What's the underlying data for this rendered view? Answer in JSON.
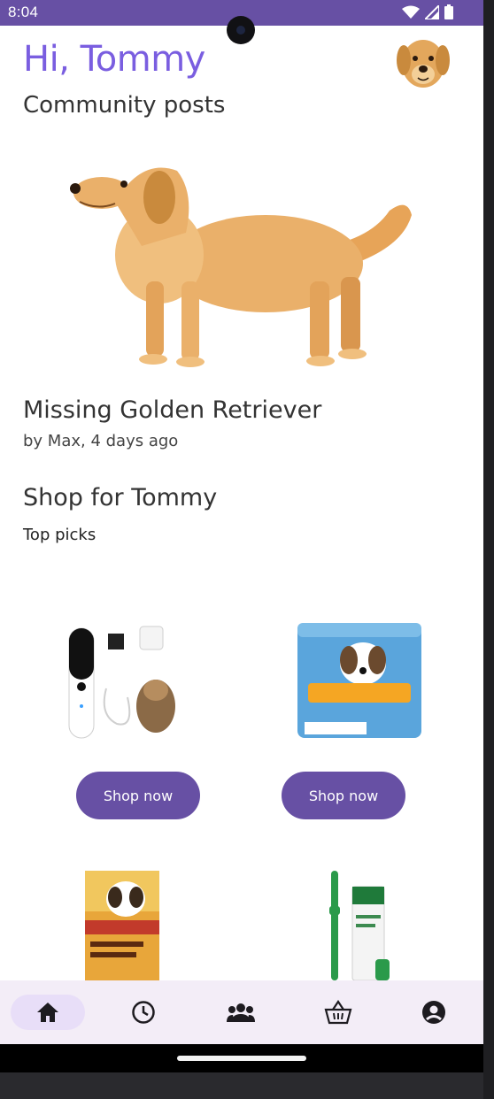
{
  "status_bar": {
    "time": "8:04",
    "icons": [
      "wifi-icon",
      "signal-icon",
      "battery-icon"
    ]
  },
  "header": {
    "greeting": "Hi, Tommy",
    "avatar_icon": "dog-avatar-icon"
  },
  "community": {
    "title": "Community posts",
    "post": {
      "image_icon": "golden-retriever-image",
      "title": "Missing Golden Retriever",
      "meta": "by Max, 4 days ago"
    }
  },
  "shop": {
    "title": "Shop for Tommy",
    "subtitle": "Top picks",
    "products": [
      {
        "image_icon": "nail-grinder-product-image",
        "button_label": "Shop now"
      },
      {
        "image_icon": "dog-wraps-product-image",
        "button_label": "Shop now"
      },
      {
        "image_icon": "flea-treatment-product-image"
      },
      {
        "image_icon": "toothpaste-kit-product-image"
      }
    ]
  },
  "bottom_nav": {
    "items": [
      {
        "icon": "home-icon",
        "active": true
      },
      {
        "icon": "clock-icon",
        "active": false
      },
      {
        "icon": "community-icon",
        "active": false
      },
      {
        "icon": "basket-icon",
        "active": false
      },
      {
        "icon": "account-icon",
        "active": false
      }
    ]
  },
  "colors": {
    "primary": "#6750a4",
    "greeting": "#7a5ee0",
    "nav_background": "#f3edf7",
    "nav_active": "#e8def8"
  }
}
